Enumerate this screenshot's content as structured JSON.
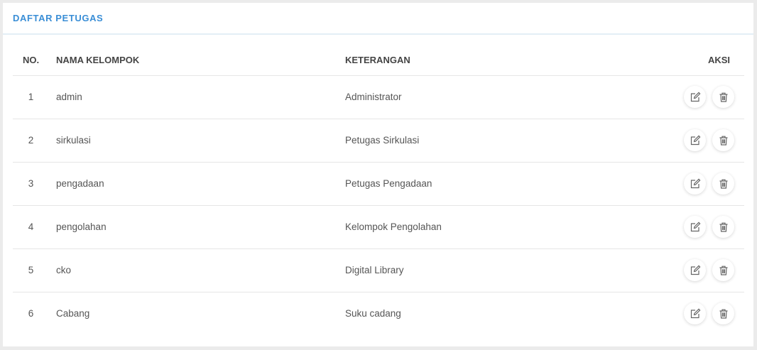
{
  "panel": {
    "title": "DAFTAR PETUGAS"
  },
  "table": {
    "headers": {
      "no": "NO.",
      "nama": "NAMA KELOMPOK",
      "keterangan": "KETERANGAN",
      "aksi": "AKSI"
    },
    "rows": [
      {
        "no": "1",
        "nama": "admin",
        "keterangan": "Administrator"
      },
      {
        "no": "2",
        "nama": "sirkulasi",
        "keterangan": "Petugas Sirkulasi"
      },
      {
        "no": "3",
        "nama": "pengadaan",
        "keterangan": "Petugas Pengadaan"
      },
      {
        "no": "4",
        "nama": "pengolahan",
        "keterangan": "Kelompok Pengolahan"
      },
      {
        "no": "5",
        "nama": "cko",
        "keterangan": "Digital Library"
      },
      {
        "no": "6",
        "nama": "Cabang",
        "keterangan": "Suku cadang"
      }
    ],
    "row_actions": [
      "edit-icon",
      "trash-icon"
    ]
  },
  "colors": {
    "accent": "#3a8ed6",
    "background": "#ebebeb",
    "card": "#ffffff",
    "text": "#555555",
    "divider": "#e6e6e6"
  }
}
